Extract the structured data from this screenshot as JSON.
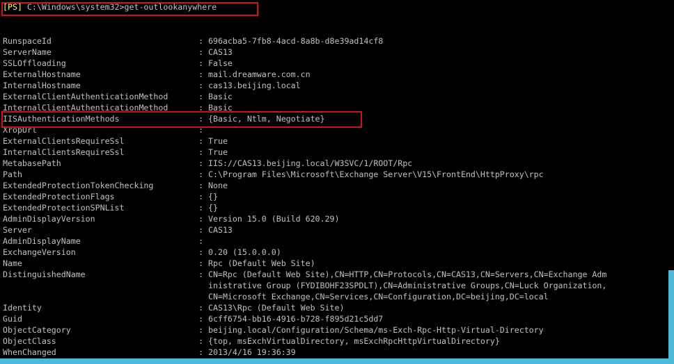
{
  "prompt": {
    "tag": "[PS]",
    "path": " C:\\Windows\\system32>",
    "command": "get-outlookanywhere"
  },
  "rows": [
    {
      "key": "RunspaceId",
      "val": "696acba5-7fb8-4acd-8a8b-d8e39ad14cf8"
    },
    {
      "key": "ServerName",
      "val": "CAS13"
    },
    {
      "key": "SSLOffloading",
      "val": "False"
    },
    {
      "key": "ExternalHostname",
      "val": "mail.dreamware.com.cn"
    },
    {
      "key": "InternalHostname",
      "val": "cas13.beijing.local"
    },
    {
      "key": "ExternalClientAuthenticationMethod",
      "val": "Basic"
    },
    {
      "key": "InternalClientAuthenticationMethod",
      "val": "Basic"
    },
    {
      "key": "IISAuthenticationMethods",
      "val": "{Basic, Ntlm, Negotiate}"
    },
    {
      "key": "XropUrl",
      "val": ""
    },
    {
      "key": "ExternalClientsRequireSsl",
      "val": "True"
    },
    {
      "key": "InternalClientsRequireSsl",
      "val": "True"
    },
    {
      "key": "MetabasePath",
      "val": "IIS://CAS13.beijing.local/W3SVC/1/ROOT/Rpc"
    },
    {
      "key": "Path",
      "val": "C:\\Program Files\\Microsoft\\Exchange Server\\V15\\FrontEnd\\HttpProxy\\rpc"
    },
    {
      "key": "ExtendedProtectionTokenChecking",
      "val": "None"
    },
    {
      "key": "ExtendedProtectionFlags",
      "val": "{}"
    },
    {
      "key": "ExtendedProtectionSPNList",
      "val": "{}"
    },
    {
      "key": "AdminDisplayVersion",
      "val": "Version 15.0 (Build 620.29)"
    },
    {
      "key": "Server",
      "val": "CAS13"
    },
    {
      "key": "AdminDisplayName",
      "val": ""
    },
    {
      "key": "ExchangeVersion",
      "val": "0.20 (15.0.0.0)"
    },
    {
      "key": "Name",
      "val": "Rpc (Default Web Site)"
    },
    {
      "key": "DistinguishedName",
      "val": "CN=Rpc (Default Web Site),CN=HTTP,CN=Protocols,CN=CAS13,CN=Servers,CN=Exchange Adm"
    },
    {
      "key": "",
      "val": "inistrative Group (FYDIBOHF23SPDLT),CN=Administrative Groups,CN=Luck Organization,"
    },
    {
      "key": "",
      "val": "CN=Microsoft Exchange,CN=Services,CN=Configuration,DC=beijing,DC=local"
    },
    {
      "key": "Identity",
      "val": "CAS13\\Rpc (Default Web Site)"
    },
    {
      "key": "Guid",
      "val": "6cff6754-bb16-4916-b728-f895d21c5dd7"
    },
    {
      "key": "ObjectCategory",
      "val": "beijing.local/Configuration/Schema/ms-Exch-Rpc-Http-Virtual-Directory"
    },
    {
      "key": "ObjectClass",
      "val": "{top, msExchVirtualDirectory, msExchRpcHttpVirtualDirectory}"
    },
    {
      "key": "WhenChanged",
      "val": "2013/4/16 19:36:39"
    }
  ],
  "separator": ": ",
  "colors": {
    "background": "#000000",
    "text": "#c0c0c0",
    "highlight": "#d0121c",
    "accent_bar": "#4fb9d8"
  }
}
